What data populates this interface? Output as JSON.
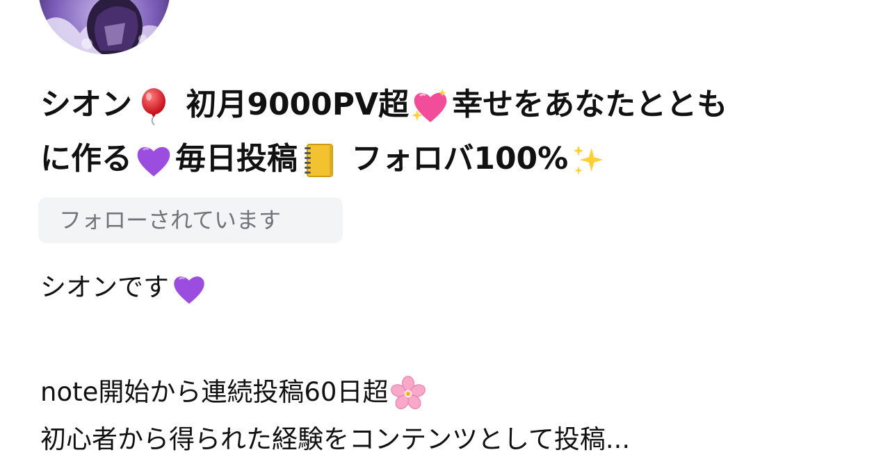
{
  "profile": {
    "name_parts": [
      "シオン",
      "初月9000PV超",
      "幸せをあなたととも",
      "に作る",
      "毎日投稿",
      "フォロバ100%"
    ],
    "follow_badge": "フォローされています",
    "bio": {
      "line1": "シオンです",
      "line2": "note開始から連続投稿60日超",
      "line3": "初心者から得られた経験をコンテンツとして投稿..."
    }
  },
  "icons": {
    "avatar": "avatar-image",
    "balloon": "balloon-emoji-icon",
    "sparkling_heart": "sparkling-heart-emoji-icon",
    "purple_heart": "purple-heart-emoji-icon",
    "notebook": "notebook-emoji-icon",
    "sparkles": "sparkles-emoji-icon",
    "cherry_blossom": "cherry-blossom-emoji-icon"
  },
  "colors": {
    "text": "#111111",
    "badge_bg": "#f2f4f6",
    "badge_text": "#6e7479",
    "purple_heart": "#9b4de0",
    "pink_heart": "#f24d9b",
    "balloon": "#e8252f"
  }
}
